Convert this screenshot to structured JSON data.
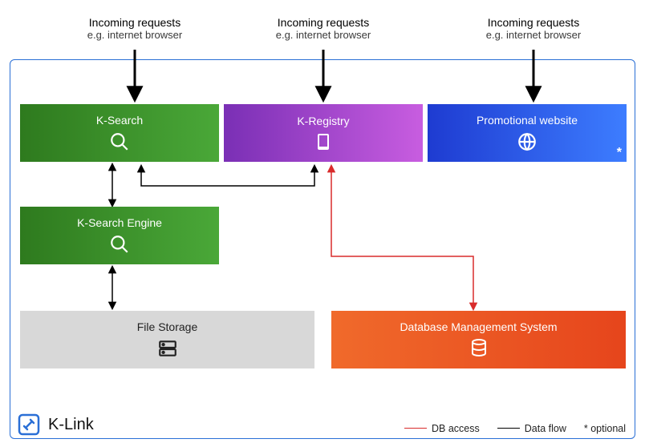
{
  "labels": {
    "incoming_title": "Incoming requests",
    "incoming_sub": "e.g. internet browser"
  },
  "boxes": {
    "ksearch": "K-Search",
    "kregistry": "K-Registry",
    "website": "Promotional website",
    "engine": "K-Search Engine",
    "storage": "File Storage",
    "dbms": "Database Management System"
  },
  "brand": "K-Link",
  "legend": {
    "db": "DB access",
    "flow": "Data flow",
    "optional": "* optional"
  },
  "annotations": {
    "optional_marker": "*"
  },
  "colors": {
    "db_access": "#d92b2b",
    "data_flow": "#000000",
    "frame": "#2a6fd6"
  }
}
